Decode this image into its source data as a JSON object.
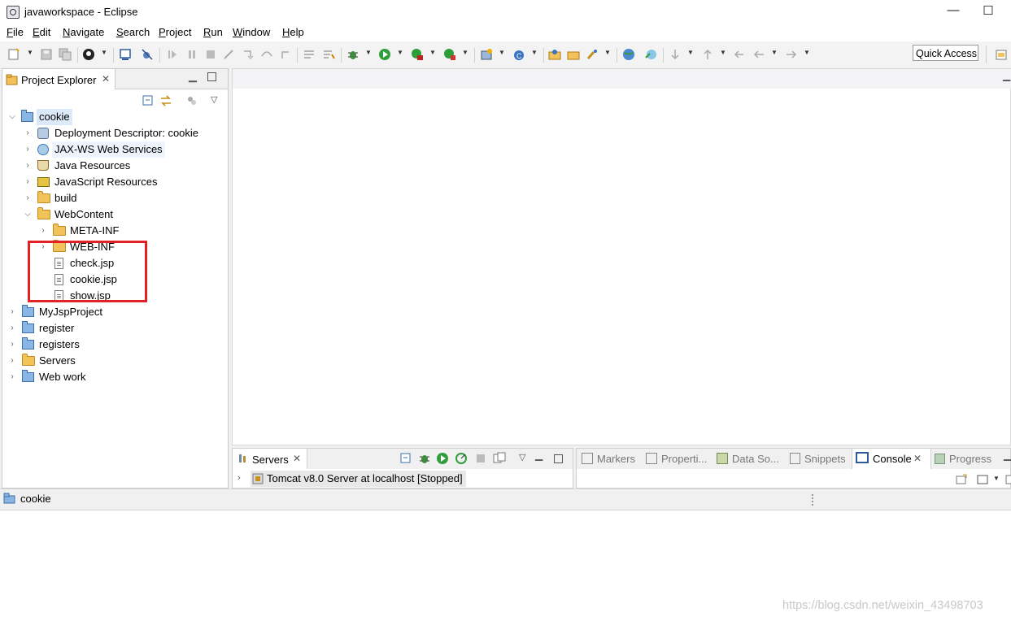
{
  "window": {
    "title": "javaworkspace - Eclipse",
    "minimize": "—",
    "maximize": "☐"
  },
  "menu": [
    "File",
    "Edit",
    "Navigate",
    "Search",
    "Project",
    "Run",
    "Window",
    "Help"
  ],
  "toolbar": {
    "quick_access": "Quick Access"
  },
  "explorer": {
    "tab_label": "Project Explorer",
    "close": "✕",
    "tree": [
      {
        "label": "cookie",
        "icon": "web-project-icon",
        "expanded": true,
        "selected": true
      },
      {
        "label": "Deployment Descriptor: cookie",
        "icon": "deployment-descriptor-icon"
      },
      {
        "label": "JAX-WS Web Services",
        "icon": "web-services-icon"
      },
      {
        "label": "Java Resources",
        "icon": "java-resources-icon"
      },
      {
        "label": "JavaScript Resources",
        "icon": "javascript-resources-icon"
      },
      {
        "label": "build",
        "icon": "folder-icon"
      },
      {
        "label": "WebContent",
        "icon": "folder-open-icon",
        "expanded": true
      },
      {
        "label": "META-INF",
        "icon": "folder-icon"
      },
      {
        "label": "WEB-INF",
        "icon": "folder-icon"
      },
      {
        "label": "check.jsp",
        "icon": "jsp-file-icon"
      },
      {
        "label": "cookie.jsp",
        "icon": "jsp-file-icon"
      },
      {
        "label": "show.jsp",
        "icon": "jsp-file-icon"
      },
      {
        "label": "MyJspProject",
        "icon": "project-icon"
      },
      {
        "label": "register",
        "icon": "project-icon"
      },
      {
        "label": "registers",
        "icon": "project-icon"
      },
      {
        "label": "Servers",
        "icon": "folder-icon"
      },
      {
        "label": "Web work",
        "icon": "web-project-icon"
      }
    ]
  },
  "servers": {
    "tab_label": "Servers",
    "close": "✕",
    "entry": "Tomcat v8.0 Server at localhost  [Stopped]"
  },
  "bottom_tabs": [
    "Markers",
    "Properti...",
    "Data So...",
    "Snippets",
    "Console",
    "Progress"
  ],
  "console": {
    "tab_label": "Console",
    "close": "✕"
  },
  "status": {
    "selection": "cookie"
  },
  "watermark": "https://blog.csdn.net/weixin_43498703",
  "colors": {
    "highlight_box": "#e32024",
    "selection_bg": "#dbe9f8"
  }
}
